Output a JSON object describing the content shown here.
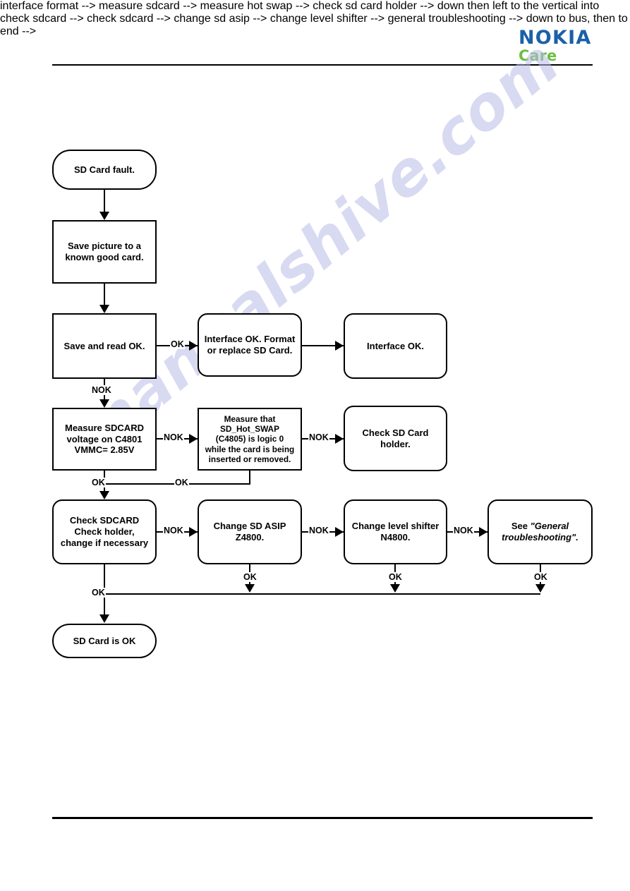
{
  "header": {
    "logo_primary": "NOKIA",
    "logo_secondary": "Care"
  },
  "watermark": {
    "text": "manualshive.com"
  },
  "flowchart": {
    "title": "SD Card fault troubleshooting",
    "nodes": [
      {
        "id": "start",
        "label": "SD Card fault.",
        "shape": "pill"
      },
      {
        "id": "save-picture",
        "label": "Save picture to  a\nknown good  card.",
        "shape": "sharp"
      },
      {
        "id": "save-read-ok",
        "label": "Save and read  OK.",
        "shape": "sharp"
      },
      {
        "id": "interface-format",
        "label": "Interface OK. Format\nor replace SD Card.",
        "shape": "rounded"
      },
      {
        "id": "interface-ok",
        "label": "Interface OK.",
        "shape": "rounded"
      },
      {
        "id": "measure-sdcard",
        "label": "Measure SDCARD\nvoltage on C4801\nVMMC= 2.85V",
        "shape": "sharp"
      },
      {
        "id": "measure-hotswap",
        "label": "Measure  that\nSD_Hot_SWAP\n(C4805) is logic 0\nwhile the card is being\ninserted or removed.",
        "shape": "sharp"
      },
      {
        "id": "check-holder",
        "label": "Check SD Card\nholder.",
        "shape": "rounded"
      },
      {
        "id": "check-sdcard",
        "label": "Check SDCARD\nCheck holder,\nchange if necessary",
        "shape": "rounded"
      },
      {
        "id": "change-asip",
        "label": "Change SD ASIP\nZ4800.",
        "shape": "rounded"
      },
      {
        "id": "change-shifter",
        "label": "Change level shifter\nN4800.",
        "shape": "rounded"
      },
      {
        "id": "general-ts",
        "label_prefix": "See ",
        "label_quoted": "\"General\ntroubleshooting\".",
        "shape": "rounded"
      },
      {
        "id": "end",
        "label": "SD Card is OK",
        "shape": "pill"
      }
    ],
    "edge_labels": {
      "save_read_ok": "OK",
      "save_read_nok": "NOK",
      "measure_sdcard_nok": "NOK",
      "measure_sdcard_ok": "OK",
      "measure_hotswap_nok": "NOK",
      "measure_hotswap_ok": "OK",
      "check_sdcard_nok": "NOK",
      "check_sdcard_ok": "OK",
      "change_asip_nok": "NOK",
      "change_asip_ok": "OK",
      "change_shifter_nok": "NOK",
      "change_shifter_ok": "OK",
      "general_ts_ok": "OK"
    }
  }
}
